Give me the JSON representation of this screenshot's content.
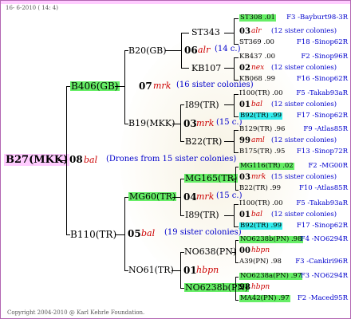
{
  "date": "16- 6-2010 ( 14: 4)",
  "root": {
    "name": "B27(MKK)"
  },
  "gen1": {
    "colonies_num": "08",
    "colonies_code": "bal",
    "colonies_note": "(Drones from 15 sister colonies)",
    "sire": "B406(GB)",
    "dam": "B110(TR)"
  },
  "gen2": {
    "a": {
      "name": "B20(GB)",
      "num": "06",
      "code": "alr",
      "note": "(14 c.)",
      "sire": "ST343",
      "dam": "KB107"
    },
    "b": {
      "num": "07",
      "code": "mrk",
      "note": "(16 sister colonies)"
    },
    "c": {
      "name": "B19(MKK)",
      "num": "03",
      "code": "mrk",
      "note": "(15 c.)",
      "sire": "I89(TR)",
      "dam": "B22(TR)"
    },
    "d": {
      "name": "MG60(TR)",
      "num": "04",
      "code": "mrk",
      "note": "(15 c.)",
      "sire": "MG165(TR)",
      "dam": "I89(TR)"
    },
    "e": {
      "num": "05",
      "code": "bal",
      "note": "(19 sister colonies)"
    },
    "f": {
      "name": "NO61(TR)",
      "num": "01",
      "code": "hbpn",
      "sire": "NO638(PN)",
      "dam": "NO6238b(PN)"
    }
  },
  "leaves": [
    {
      "name": "ST308 .01",
      "hl": "g",
      "right": "F3 -Bayburt98-3R"
    },
    {
      "num": "03",
      "code": "alr",
      "note": "(12 sister colonies)"
    },
    {
      "name": "ST369 .00",
      "right": "F18 -Sinop62R"
    },
    {
      "name": "KB437 .00",
      "right": "F2 -Sinop96R"
    },
    {
      "num": "02",
      "code": "nex",
      "note": "(12 sister colonies)"
    },
    {
      "name": "KB068 .99",
      "right": "F16 -Sinop62R"
    },
    {
      "name": "I100(TR) .00",
      "right": "F5 -Takab93aR"
    },
    {
      "num": "01",
      "code": "bal",
      "note": "(12 sister colonies)"
    },
    {
      "name": "B92(TR) .99",
      "hl": "c",
      "right": "F17 -Sinop62R"
    },
    {
      "name": "B129(TR) .96",
      "right": "F9 -Atlas85R"
    },
    {
      "num": "99",
      "code": "aml",
      "note": "(12 sister colonies)"
    },
    {
      "name": "B175(TR) .95",
      "right": "F13 -Sinop72R"
    },
    {
      "name": "MG116(TR) .02",
      "hl": "g",
      "right": "F2 -MG00R"
    },
    {
      "num": "03",
      "code": "mrk",
      "note": "(15 sister colonies)"
    },
    {
      "name": "B22(TR) .99",
      "right": "F10 -Atlas85R"
    },
    {
      "name": "I100(TR) .00",
      "right": "F5 -Takab93aR"
    },
    {
      "num": "01",
      "code": "bal",
      "note": "(12 sister colonies)"
    },
    {
      "name": "B92(TR) .99",
      "hl": "c",
      "right": "F17 -Sinop62R"
    },
    {
      "name": "NO6238b(PN) .98",
      "hl": "g",
      "right": "F4 -NO6294R"
    },
    {
      "num": "00",
      "code": "hbpn",
      "note": ""
    },
    {
      "name": "A39(PN) .98",
      "right": "F3 -Cankiri96R"
    },
    {
      "name": "NO6238a(PN) .97",
      "hl": "g",
      "right": "F3 -NO6294R"
    },
    {
      "num": "98",
      "code": "hbpn",
      "note": ""
    },
    {
      "name": "MA42(PN) .97",
      "hl": "g",
      "right": "F2 -Maced95R"
    }
  ],
  "copyright": "Copyright 2004-2010 @ Karl Kehrle Foundation."
}
